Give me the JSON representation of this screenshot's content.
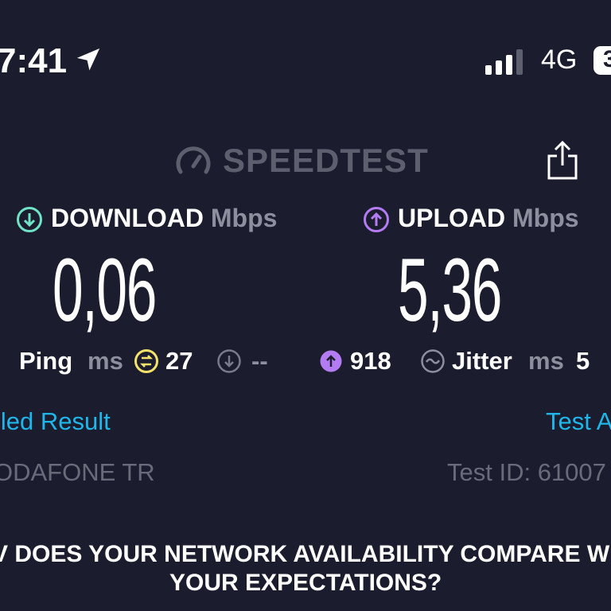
{
  "status_bar": {
    "time": "7:41",
    "network": "4G",
    "battery": "3"
  },
  "header": {
    "logo_text": "SPEEDTEST"
  },
  "download": {
    "label": "DOWNLOAD",
    "unit": "Mbps",
    "value": "0,06"
  },
  "upload": {
    "label": "UPLOAD",
    "unit": "Mbps",
    "value": "5,36"
  },
  "metrics": {
    "ping_label": "Ping",
    "ping_unit": "ms",
    "ping_idle": "27",
    "ping_download": "--",
    "ping_upload": "918",
    "jitter_label": "Jitter",
    "jitter_unit": "ms",
    "jitter_value": "5"
  },
  "links": {
    "detailed_result": "iled Result",
    "test_again": "Test A"
  },
  "info": {
    "carrier": "ODAFONE TR",
    "test_id": "Test ID: 61007"
  },
  "survey": {
    "line1": "V DOES YOUR NETWORK AVAILABILITY COMPARE W",
    "line2": "YOUR EXPECTATIONS?"
  },
  "colors": {
    "background": "#1b1c2e",
    "download_accent": "#6fe2c7",
    "upload_accent": "#b47cf2",
    "ping_accent": "#f3e36b",
    "link": "#1fb6ea"
  }
}
